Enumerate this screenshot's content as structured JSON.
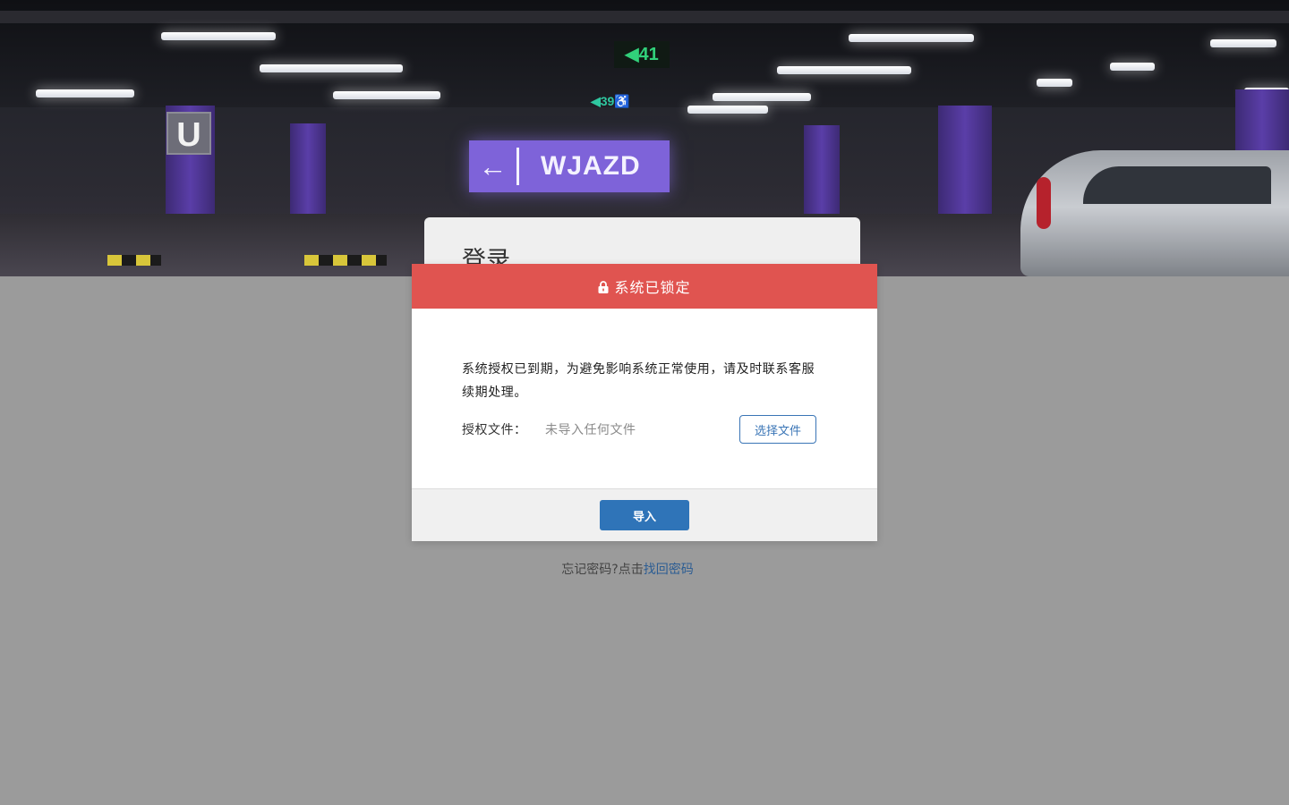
{
  "background": {
    "u_sign": "U",
    "exit_number_1": "◀41",
    "exit_number_2": "◀39♿",
    "wjazd_arrow": "←",
    "wjazd_text": "WJAZD"
  },
  "login": {
    "title": "登录"
  },
  "modal": {
    "header_color": "#e05450",
    "icon": "lock-icon",
    "title": "系统已锁定",
    "message": "系统授权已到期，为避免影响系统正常使用，请及时联系客服续期处理。",
    "file_label": "授权文件：",
    "file_placeholder": "未导入任何文件",
    "choose_file_button": "选择文件",
    "import_button": "导入"
  },
  "forgot": {
    "prefix": "忘记密码?点击",
    "link": "找回密码"
  },
  "colors": {
    "primary": "#2f74b8",
    "danger": "#e05450",
    "overlay": "#9b9b9b"
  }
}
